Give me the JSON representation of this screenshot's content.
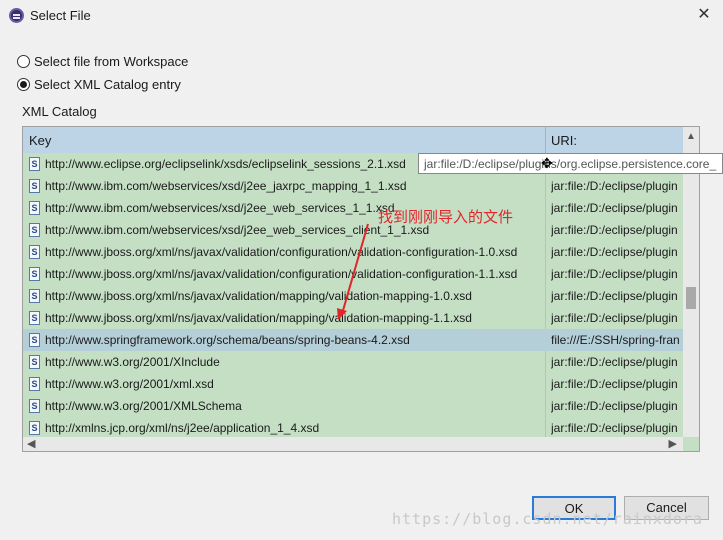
{
  "window": {
    "title": "Select File",
    "close_glyph": "✕"
  },
  "source": {
    "workspace_label": "Select file from Workspace",
    "catalog_label": "Select XML Catalog entry",
    "selected": "catalog"
  },
  "catalog": {
    "section_label": "XML Catalog",
    "headers": {
      "key": "Key",
      "uri": "URI:"
    },
    "rows": [
      {
        "key": "http://www.eclipse.org/eclipselink/xsds/eclipselink_sessions_2.1.xsd",
        "uri": "jar:file:/D:/eclipse/plugin"
      },
      {
        "key": "http://www.ibm.com/webservices/xsd/j2ee_jaxrpc_mapping_1_1.xsd",
        "uri": "jar:file:/D:/eclipse/plugin"
      },
      {
        "key": "http://www.ibm.com/webservices/xsd/j2ee_web_services_1_1.xsd",
        "uri": "jar:file:/D:/eclipse/plugin"
      },
      {
        "key": "http://www.ibm.com/webservices/xsd/j2ee_web_services_client_1_1.xsd",
        "uri": "jar:file:/D:/eclipse/plugin"
      },
      {
        "key": "http://www.jboss.org/xml/ns/javax/validation/configuration/validation-configuration-1.0.xsd",
        "uri": "jar:file:/D:/eclipse/plugin"
      },
      {
        "key": "http://www.jboss.org/xml/ns/javax/validation/configuration/validation-configuration-1.1.xsd",
        "uri": "jar:file:/D:/eclipse/plugin"
      },
      {
        "key": "http://www.jboss.org/xml/ns/javax/validation/mapping/validation-mapping-1.0.xsd",
        "uri": "jar:file:/D:/eclipse/plugin"
      },
      {
        "key": "http://www.jboss.org/xml/ns/javax/validation/mapping/validation-mapping-1.1.xsd",
        "uri": "jar:file:/D:/eclipse/plugin"
      },
      {
        "key": "http://www.springframework.org/schema/beans/spring-beans-4.2.xsd",
        "uri": "file:///E:/SSH/spring-fran",
        "selected": true
      },
      {
        "key": "http://www.w3.org/2001/XInclude",
        "uri": "jar:file:/D:/eclipse/plugin"
      },
      {
        "key": "http://www.w3.org/2001/xml.xsd",
        "uri": "jar:file:/D:/eclipse/plugin"
      },
      {
        "key": "http://www.w3.org/2001/XMLSchema",
        "uri": "jar:file:/D:/eclipse/plugin"
      },
      {
        "key": "http://xmlns.jcp.org/xml/ns/j2ee/application_1_4.xsd",
        "uri": "jar:file:/D:/eclipse/plugin"
      }
    ],
    "row_icon": "xsd-file-icon",
    "row_icon_glyph": "S",
    "tooltip": "jar:file:/D:/eclipse/plugins/org.eclipse.persistence.core_"
  },
  "annotation": {
    "text": "找到刚刚导入的文件",
    "color": "#e0262b"
  },
  "buttons": {
    "ok": "OK",
    "cancel": "Cancel"
  },
  "watermark": "https://blog.csdn.net/rainxdora"
}
